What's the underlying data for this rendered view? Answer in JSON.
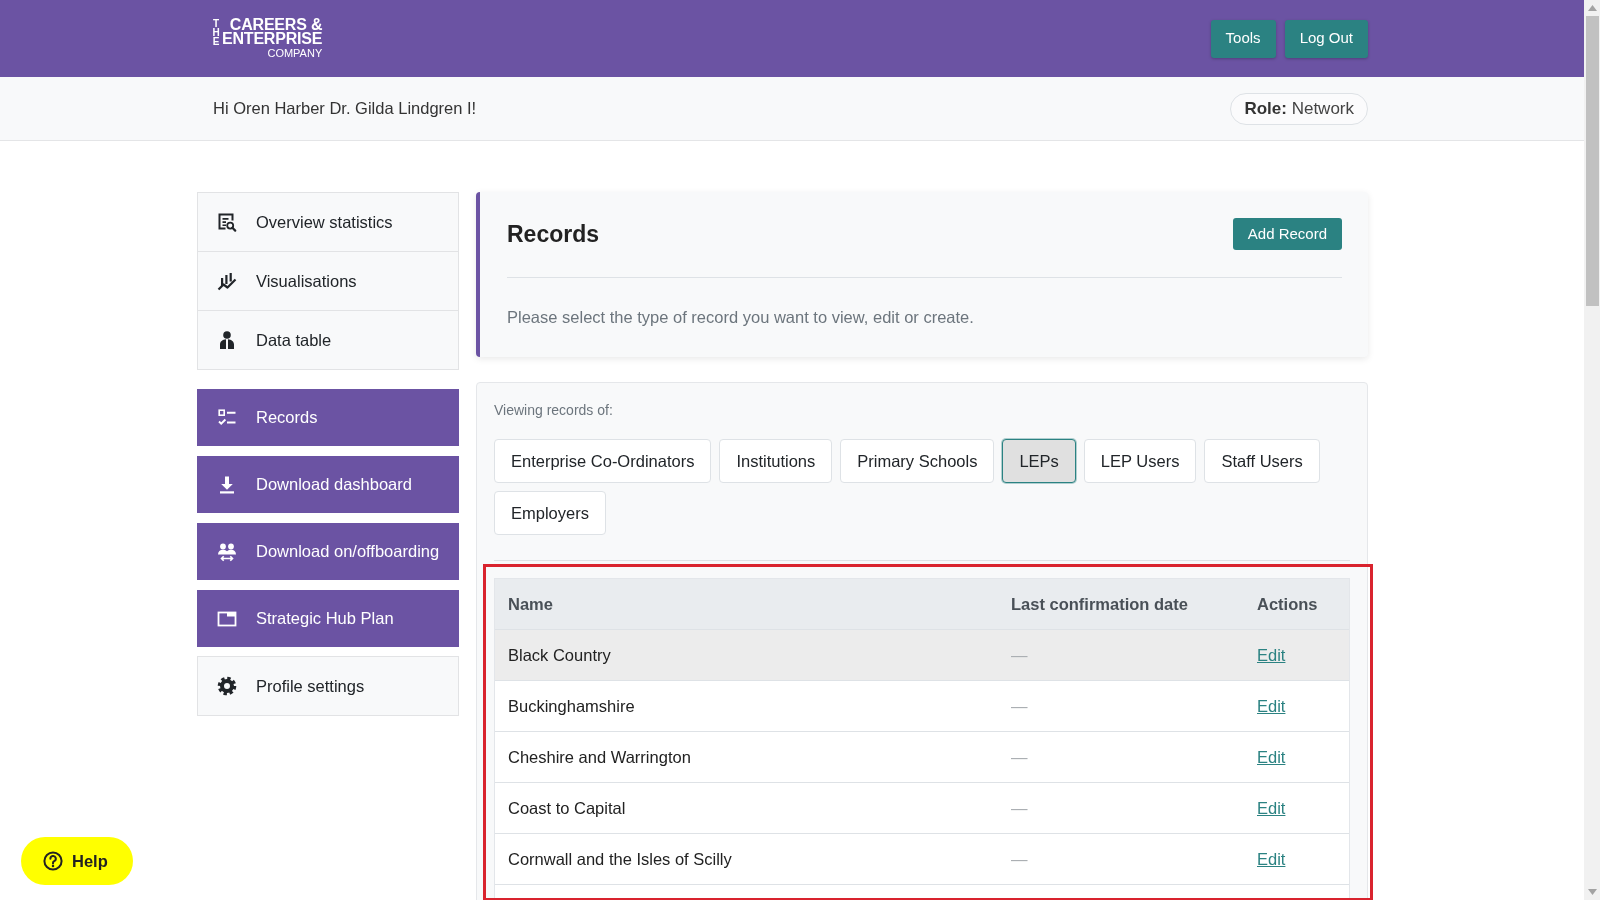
{
  "header": {
    "logo": {
      "small": "THE",
      "lines": [
        "CAREERS &",
        "ENTERPRISE"
      ],
      "sub": "COMPANY"
    },
    "buttons": [
      "Tools",
      "Log Out"
    ]
  },
  "greeting_bar": {
    "greeting": "Hi Oren Harber Dr. Gilda Lindgren I!",
    "role": "**Role:** Network"
  },
  "sidebar": {
    "items": [
      {
        "label": "Overview statistics",
        "kind": "plain"
      },
      {
        "label": "Visualisations",
        "kind": "plain"
      },
      {
        "label": "Data table",
        "kind": "plain"
      },
      {
        "label": "Records",
        "kind": "accent"
      },
      {
        "label": "Download dashboard",
        "kind": "accent"
      },
      {
        "label": "Download on/offboarding",
        "kind": "accent"
      },
      {
        "label": "Strategic Hub Plan",
        "kind": "accent"
      },
      {
        "label": "Profile settings",
        "kind": "plain"
      }
    ]
  },
  "records_panel": {
    "title": "Records",
    "button": "Add Record",
    "description": "Please select the type of record you want to view, edit or create."
  },
  "record_types": {
    "label": "Viewing records of:",
    "options": [
      {
        "label": "Enterprise Co-Ordinators",
        "selected": false
      },
      {
        "label": "Institutions",
        "selected": false
      },
      {
        "label": "Primary Schools",
        "selected": false
      },
      {
        "label": "LEPs",
        "selected": true
      },
      {
        "label": "LEP Users",
        "selected": false
      },
      {
        "label": "Staff Users",
        "selected": false
      },
      {
        "label": "Employers",
        "selected": false
      }
    ]
  },
  "table": {
    "outlined": true,
    "columns": [
      "Name",
      "Last confirmation date",
      "Actions"
    ],
    "rows": [
      {
        "name": "Black Country",
        "date": "—",
        "action": "Edit",
        "highlighted": true
      },
      {
        "name": "Buckinghamshire",
        "date": "—",
        "action": "Edit",
        "highlighted": false
      },
      {
        "name": "Cheshire and Warrington",
        "date": "—",
        "action": "Edit",
        "highlighted": false
      },
      {
        "name": "Coast to Capital",
        "date": "—",
        "action": "Edit",
        "highlighted": false
      },
      {
        "name": "Cornwall and the Isles of Scilly",
        "date": "—",
        "action": "Edit",
        "highlighted": false
      }
    ]
  },
  "help_button": {
    "label": "Help"
  }
}
